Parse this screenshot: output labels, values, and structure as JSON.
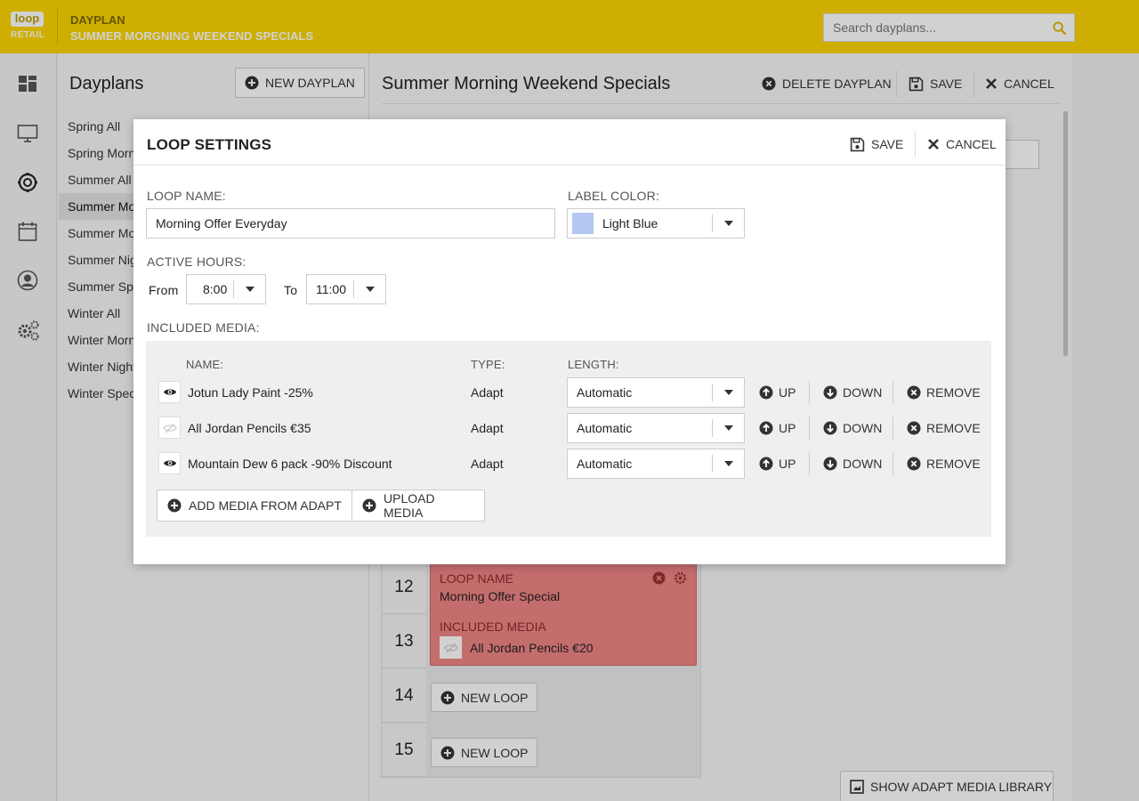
{
  "header": {
    "logo_text": "loop",
    "logo_sub": "RETAIL",
    "section": "DAYPLAN",
    "title": "SUMMER MORGNING WEEKEND SPECIALS",
    "search_placeholder": "Search dayplans..."
  },
  "rail": {
    "icons": [
      "dashboard-icon",
      "screen-icon",
      "dayplan-icon",
      "calendar-icon",
      "user-icon",
      "settings-icon"
    ]
  },
  "dayplans": {
    "title": "Dayplans",
    "new_button": "NEW DAYPLAN",
    "items": [
      {
        "label": "Spring All"
      },
      {
        "label": "Spring Morn"
      },
      {
        "label": "Summer All"
      },
      {
        "label": "Summer Mo"
      },
      {
        "label": "Summer Mo"
      },
      {
        "label": "Summer Nig"
      },
      {
        "label": "Summer Spe"
      },
      {
        "label": "Winter All"
      },
      {
        "label": "Winter Morn"
      },
      {
        "label": "Winter Night"
      },
      {
        "label": "Winter Spec"
      }
    ],
    "selected_index": 3
  },
  "main": {
    "title": "Summer Morning Weekend Specials",
    "delete_label": "DELETE DAYPLAN",
    "save_label": "SAVE",
    "cancel_label": "CANCEL"
  },
  "schedule": {
    "rows": [
      "12",
      "13",
      "14",
      "15"
    ],
    "loop_card": {
      "name_label": "LOOP NAME",
      "name": "Morning Offer Special",
      "media_label": "INCLUDED MEDIA",
      "media": "All Jordan Pencils €20",
      "color": "#f08686"
    },
    "new_loop_label": "NEW LOOP",
    "show_library_label": "SHOW ADAPT MEDIA LIBRARY"
  },
  "modal": {
    "title": "LOOP SETTINGS",
    "save_label": "SAVE",
    "cancel_label": "CANCEL",
    "loop_name_label": "LOOP NAME:",
    "loop_name_value": "Morning Offer Everyday",
    "label_color_label": "LABEL COLOR:",
    "label_color_value": "Light Blue",
    "label_color_swatch": "#b3c7f2",
    "active_hours_label": "ACTIVE HOURS:",
    "from_label": "From",
    "from_value": "8:00",
    "to_label": "To",
    "to_value": "11:00",
    "included_media_label": "INCLUDED MEDIA:",
    "columns": {
      "name": "NAME:",
      "type": "TYPE:",
      "length": "LENGTH:"
    },
    "media": [
      {
        "name": "Jotun Lady Paint -25%",
        "type": "Adapt",
        "length": "Automatic",
        "visible": true
      },
      {
        "name": "All Jordan Pencils €35",
        "type": "Adapt",
        "length": "Automatic",
        "visible": false
      },
      {
        "name": "Mountain Dew 6 pack -90% Discount",
        "type": "Adapt",
        "length": "Automatic",
        "visible": true
      }
    ],
    "up_label": "UP",
    "down_label": "DOWN",
    "remove_label": "REMOVE",
    "add_media_label": "ADD MEDIA FROM ADAPT",
    "upload_media_label": "UPLOAD MEDIA"
  },
  "colors": {
    "brand": "#fcd500",
    "danger": "#f08686"
  }
}
